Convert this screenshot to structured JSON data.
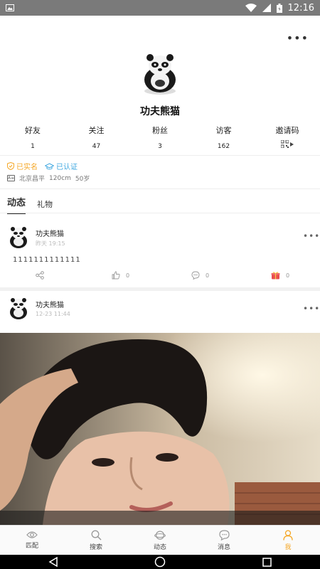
{
  "status_bar": {
    "time": "12:16"
  },
  "profile": {
    "name": "功夫熊猫"
  },
  "stats": [
    {
      "label": "好友",
      "value": "1"
    },
    {
      "label": "关注",
      "value": "47"
    },
    {
      "label": "粉丝",
      "value": "3"
    },
    {
      "label": "访客",
      "value": "162"
    },
    {
      "label": "邀请码",
      "value": ""
    }
  ],
  "badges": {
    "realname": "已实名",
    "verified": "已认证"
  },
  "info": {
    "location": "北京昌平",
    "height": "120cm",
    "weight": "50岁"
  },
  "tabs": [
    {
      "label": "动态",
      "active": true
    },
    {
      "label": "礼物",
      "active": false
    }
  ],
  "posts": [
    {
      "author": "功夫熊猫",
      "time": "昨天 19:15",
      "content": "1111111111111",
      "likes": "0",
      "comments": "0",
      "gifts": "0"
    },
    {
      "author": "功夫熊猫",
      "time": "12-23 11:44"
    }
  ],
  "bottom_nav": [
    {
      "label": "匹配",
      "icon": "eye-icon",
      "active": false
    },
    {
      "label": "搜索",
      "icon": "search-icon",
      "active": false
    },
    {
      "label": "动态",
      "icon": "planet-icon",
      "active": false
    },
    {
      "label": "消息",
      "icon": "message-icon",
      "active": false
    },
    {
      "label": "我",
      "icon": "person-icon",
      "active": true
    }
  ],
  "colors": {
    "accent": "#f5a623",
    "verified": "#3ea7e0",
    "status_bar": "#7a7a7a"
  }
}
